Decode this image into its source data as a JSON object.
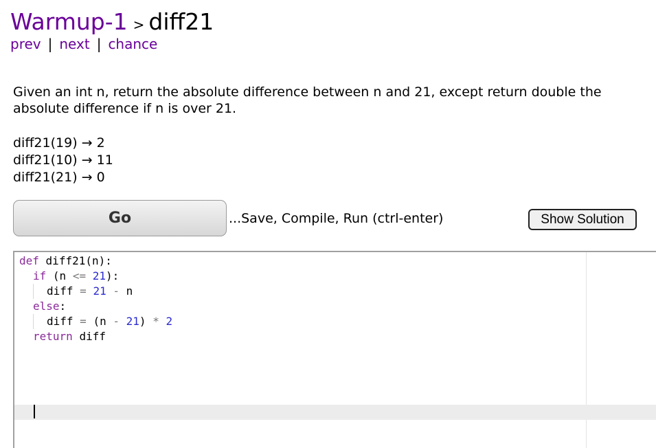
{
  "header": {
    "section": "Warmup-1",
    "separator": ">",
    "problem": "diff21"
  },
  "nav": {
    "prev": "prev",
    "next": "next",
    "chance": "chance",
    "divider": "|"
  },
  "description": "Given an int n, return the absolute difference between n and 21, except return double the absolute difference if n is over 21.",
  "examples": [
    "diff21(19) → 2",
    "diff21(10) → 11",
    "diff21(21) → 0"
  ],
  "toolbar": {
    "go_label": "Go",
    "hint": "...Save, Compile, Run (ctrl-enter)",
    "solution_label": "Show Solution"
  },
  "editor": {
    "code": [
      "def diff21(n):",
      "  if (n <= 21):",
      "    diff = 21 - n",
      "  else:",
      "    diff = (n - 21) * 2",
      "  return diff",
      "",
      "",
      "",
      "",
      ""
    ]
  },
  "colors": {
    "link": "#6a0099",
    "keyword": "#8a2a9a",
    "number": "#2a2ad0"
  }
}
